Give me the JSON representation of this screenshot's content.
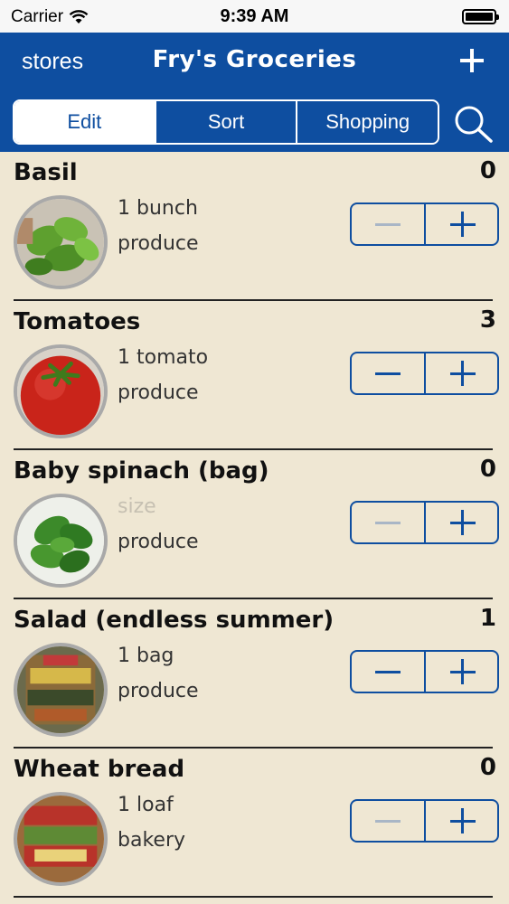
{
  "status_bar": {
    "carrier": "Carrier",
    "time": "9:39 AM"
  },
  "nav": {
    "left_label": "stores",
    "title": "Fry's Groceries",
    "add_icon": "plus-icon",
    "search_icon": "search-icon"
  },
  "segments": [
    {
      "label": "Edit",
      "selected": true
    },
    {
      "label": "Sort",
      "selected": false
    },
    {
      "label": "Shopping",
      "selected": false
    }
  ],
  "items": [
    {
      "name": "Basil",
      "count": "0",
      "quantity": "1 bunch",
      "quantity_is_placeholder": false,
      "category": "produce",
      "minus_enabled": false,
      "image": "basil"
    },
    {
      "name": "Tomatoes",
      "count": "3",
      "quantity": "1 tomato",
      "quantity_is_placeholder": false,
      "category": "produce",
      "minus_enabled": true,
      "image": "tomato"
    },
    {
      "name": "Baby spinach (bag)",
      "count": "0",
      "quantity": "size",
      "quantity_is_placeholder": true,
      "category": "produce",
      "minus_enabled": false,
      "image": "spinach"
    },
    {
      "name": "Salad (endless summer)",
      "count": "1",
      "quantity": "1 bag",
      "quantity_is_placeholder": false,
      "category": "produce",
      "minus_enabled": true,
      "image": "salad"
    },
    {
      "name": "Wheat bread",
      "count": "0",
      "quantity": "1 loaf",
      "quantity_is_placeholder": false,
      "category": "bakery",
      "minus_enabled": false,
      "image": "bread"
    }
  ],
  "colors": {
    "nav_blue": "#0e4ea0",
    "paper": "#efe7d3",
    "disabled_minus": "#a9b6c6"
  }
}
